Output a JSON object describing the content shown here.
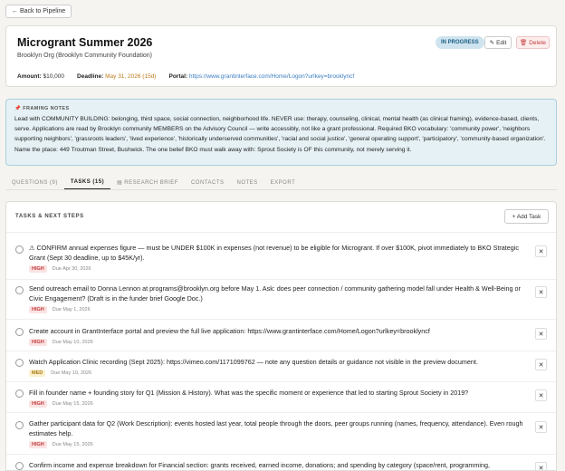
{
  "nav": {
    "back_label": "← Back to Pipeline"
  },
  "header": {
    "title": "Microgrant Summer 2026",
    "org": "Brooklyn Org (Brooklyn Community Foundation)",
    "status": "IN PROGRESS",
    "edit_label": "Edit",
    "delete_label": "Delete",
    "amount_label": "Amount:",
    "amount_value": "$10,000",
    "deadline_label": "Deadline:",
    "deadline_value": "May 31, 2026 (15d)",
    "portal_label": "Portal:",
    "portal_value": "https://www.grantinterface.com/Home/Logon?urlkey=brooklyncf"
  },
  "framing_notes": {
    "label": "FRAMING NOTES",
    "text": "Lead with COMMUNITY BUILDING: belonging, third space, social connection, neighborhood life. NEVER use: therapy, counseling, clinical, mental health (as clinical framing), evidence-based, clients, serve. Applications are read by Brooklyn community MEMBERS on the Advisory Council — write accessibly, not like a grant professional. Required BKO vocabulary: 'community power', 'neighbors supporting neighbors', 'grassroots leaders', 'lived experience', 'historically underserved communities', 'racial and social justice', 'general operating support', 'participatory', 'community-based organization'. Name the place: 449 Troutman Street, Bushwick. The one belief BKO must walk away with: Sprout Society is OF this community, not merely serving it."
  },
  "tabs": [
    {
      "label": "QUESTIONS (9)"
    },
    {
      "label": "TASKS (15)"
    },
    {
      "label": "RESEARCH BRIEF"
    },
    {
      "label": "CONTACTS"
    },
    {
      "label": "NOTES"
    },
    {
      "label": "EXPORT"
    }
  ],
  "tasks_panel": {
    "heading": "TASKS & NEXT STEPS",
    "add_label": "+ Add Task",
    "tasks": [
      {
        "text": "⚠ CONFIRM annual expenses figure — must be UNDER $100K in expenses (not revenue) to be eligible for Microgrant. If over $100K, pivot immediately to BKO Strategic Grant (Sept 30 deadline, up to $45K/yr).",
        "priority": "HIGH",
        "due": "Due Apr 30, 2026"
      },
      {
        "text": "Send outreach email to Donna Lennon at programs@brooklyn.org before May 1. Ask: does peer connection / community gathering model fall under Health & Well-Being or Civic Engagement? (Draft is in the funder brief Google Doc.)",
        "priority": "HIGH",
        "due": "Due May 1, 2026"
      },
      {
        "text": "Create account in GrantInterface portal and preview the full live application: https://www.grantinterface.com/Home/Logon?urlkey=brooklyncf",
        "priority": "HIGH",
        "due": "Due May 10, 2026"
      },
      {
        "text": "Watch Application Clinic recording (Sept 2025): https://vimeo.com/1171099762 — note any question details or guidance not visible in the preview document.",
        "priority": "MED",
        "due": "Due May 10, 2026"
      },
      {
        "text": "Fill in founder name + founding story for Q1 (Mission & History). What was the specific moment or experience that led to starting Sprout Society in 2019?",
        "priority": "HIGH",
        "due": "Due May 15, 2026"
      },
      {
        "text": "Gather participant data for Q2 (Work Description): events hosted last year, total people through the doors, peer groups running (names, frequency, attendance). Even rough estimates help.",
        "priority": "HIGH",
        "due": "Due May 15, 2026"
      },
      {
        "text": "Confirm income and expense breakdown for Financial section: grants received, earned income, donations; and spending by category (space/rent, programming,",
        "priority": "",
        "due": ""
      }
    ]
  }
}
